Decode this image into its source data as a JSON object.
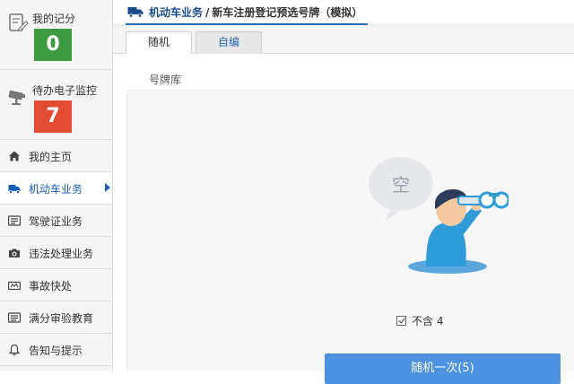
{
  "sidebar": {
    "stats": [
      {
        "label": "我的记分",
        "value": "0",
        "color": "#3e9a3e",
        "icon": "score-document-icon"
      },
      {
        "label": "待办电子监控",
        "value": "7",
        "color": "#e24c33",
        "icon": "surveillance-camera-icon"
      }
    ],
    "nav": [
      {
        "label": "我的主页",
        "icon": "home-icon"
      },
      {
        "label": "机动车业务",
        "icon": "truck-icon",
        "active": true
      },
      {
        "label": "驾驶证业务",
        "icon": "license-card-icon"
      },
      {
        "label": "违法处理业务",
        "icon": "camera-icon"
      },
      {
        "label": "事故快处",
        "icon": "accident-icon"
      },
      {
        "label": "满分审验教育",
        "icon": "education-icon"
      },
      {
        "label": "告知与提示",
        "icon": "bell-icon"
      }
    ]
  },
  "header": {
    "section": "机动车业务",
    "separator": "/",
    "page": "新车注册登记预选号牌（模拟）"
  },
  "tabs": [
    {
      "label": "随机",
      "active": true
    },
    {
      "label": "自编",
      "active": false
    }
  ],
  "main": {
    "section_title": "号牌库",
    "empty_text": "空",
    "checkbox_label": "不含 4",
    "checkbox_checked": true,
    "button_label": "随机一次(5)"
  },
  "colors": {
    "accent": "#4d92e0",
    "nav_active": "#1a5db5",
    "badge_green": "#3e9a3e",
    "badge_red": "#e24c33"
  }
}
